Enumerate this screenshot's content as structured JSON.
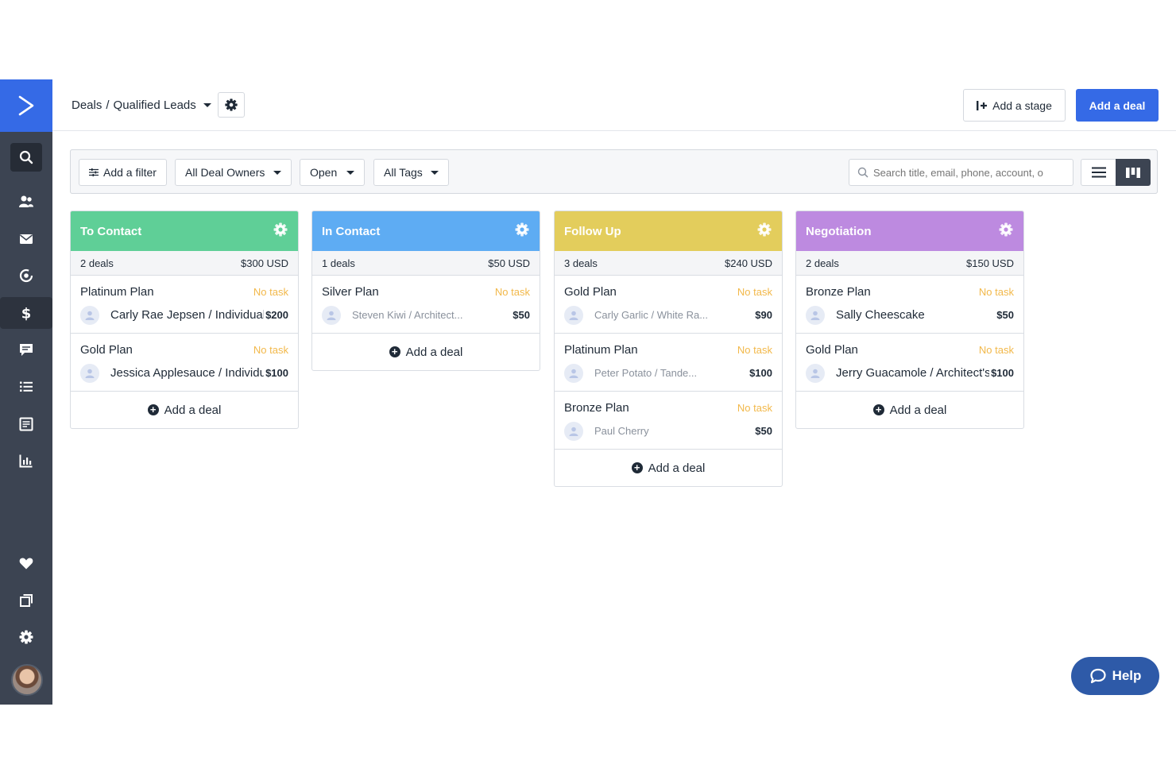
{
  "header": {
    "breadcrumb_root": "Deals",
    "breadcrumb_sep": "/",
    "breadcrumb_pipeline": "Qualified Leads",
    "add_stage_label": "Add a stage",
    "add_deal_label": "Add a deal"
  },
  "filters": {
    "add_filter_label": "Add a filter",
    "owners_label": "All Deal Owners",
    "status_label": "Open",
    "tags_label": "All Tags",
    "search_placeholder": "Search title, email, phone, account, o"
  },
  "columns": [
    {
      "name": "To Contact",
      "color": "#5fcf97",
      "count_label": "2 deals",
      "total_label": "$300 USD",
      "add_label": "Add a deal",
      "deals": [
        {
          "title": "Platinum Plan",
          "task": "No task",
          "contact": "Carly Rae Jepsen / Individual In",
          "value": "$200"
        },
        {
          "title": "Gold Plan",
          "task": "No task",
          "contact": "Jessica Applesauce / Individual",
          "value": "$100"
        }
      ]
    },
    {
      "name": "In Contact",
      "color": "#5eacf3",
      "count_label": "1 deals",
      "total_label": "$50 USD",
      "add_label": "Add a deal",
      "deals": [
        {
          "title": "Silver Plan",
          "task": "No task",
          "contact": "Steven Kiwi / Architect...",
          "value": "$50"
        }
      ]
    },
    {
      "name": "Follow Up",
      "color": "#e3cd5c",
      "count_label": "3 deals",
      "total_label": "$240 USD",
      "add_label": "Add a deal",
      "deals": [
        {
          "title": "Gold Plan",
          "task": "No task",
          "contact": "Carly Garlic / White Ra...",
          "value": "$90"
        },
        {
          "title": "Platinum Plan",
          "task": "No task",
          "contact": "Peter Potato / Tande...",
          "value": "$100"
        },
        {
          "title": "Bronze Plan",
          "task": "No task",
          "contact": "Paul Cherry",
          "value": "$50"
        }
      ]
    },
    {
      "name": "Negotiation",
      "color": "#bd8ae0",
      "count_label": "2 deals",
      "total_label": "$150 USD",
      "add_label": "Add a deal",
      "deals": [
        {
          "title": "Bronze Plan",
          "task": "No task",
          "contact": "Sally Cheescake",
          "value": "$50"
        },
        {
          "title": "Gold Plan",
          "task": "No task",
          "contact": "Jerry Guacamole / Architect's F",
          "value": "$100"
        }
      ]
    }
  ],
  "help_label": "Help",
  "colors": {
    "brand": "#356ae6",
    "sidebar": "#3c4452",
    "task": "#f2b84a"
  },
  "icons": [
    "logo-chevron-icon",
    "search-icon",
    "contacts-icon",
    "mail-icon",
    "automation-icon",
    "dollar-icon",
    "conversations-icon",
    "list-icon",
    "forms-icon",
    "reports-icon",
    "heart-icon",
    "pages-icon",
    "gear-icon"
  ]
}
